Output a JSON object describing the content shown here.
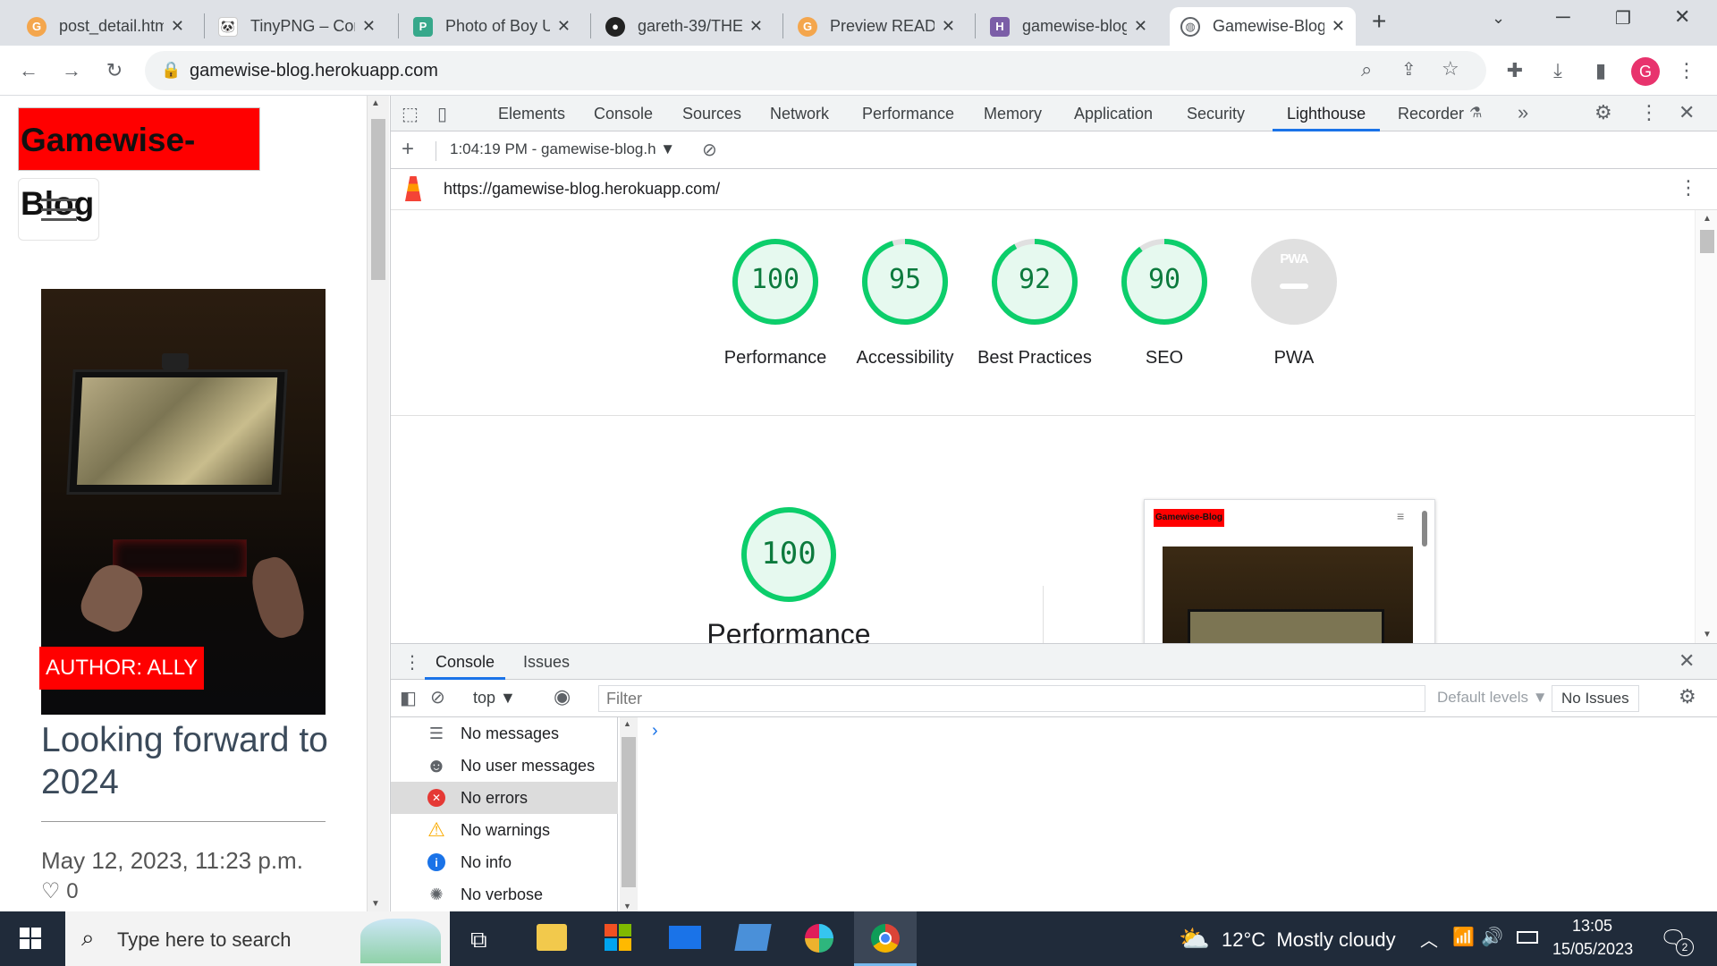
{
  "browser": {
    "tabs": [
      {
        "title": "post_detail.htm",
        "fav_color": "#f4a64d",
        "icon": "gitpod-icon",
        "active": false
      },
      {
        "title": "TinyPNG – Com",
        "fav_color": "#ffffff",
        "icon": "panda-icon",
        "active": false
      },
      {
        "title": "Photo of Boy U",
        "fav_color": "#37a88b",
        "icon": "pexels-icon",
        "active": false
      },
      {
        "title": "gareth-39/THE",
        "fav_color": "#222222",
        "icon": "github-icon",
        "active": false
      },
      {
        "title": "Preview READM",
        "fav_color": "#f4a64d",
        "icon": "gitpod-icon",
        "active": false
      },
      {
        "title": "gamewise-blog",
        "fav_color": "#7b5ea7",
        "icon": "heroku-icon",
        "active": false
      },
      {
        "title": "Gamewise-Blog",
        "fav_color": "#5f6368",
        "icon": "globe-icon",
        "active": true
      }
    ],
    "url": "gamewise-blog.herokuapp.com",
    "profile_initial": "G"
  },
  "page": {
    "brand": "Gamewise-Blog",
    "author_badge": "AUTHOR: ALLY",
    "post_title": "Looking forward to 2024",
    "post_date": "May 12, 2023, 11:23 p.m.",
    "likes": "0"
  },
  "devtools": {
    "tabs": [
      "Elements",
      "Console",
      "Sources",
      "Network",
      "Performance",
      "Memory",
      "Application",
      "Security",
      "Lighthouse",
      "Recorder"
    ],
    "active_tab": "Lighthouse",
    "report_selector": "1:04:19 PM - gamewise-blog.h",
    "report_url": "https://gamewise-blog.herokuapp.com/",
    "scores": [
      {
        "value": "100",
        "label": "Performance",
        "fraction": 1.0
      },
      {
        "value": "95",
        "label": "Accessibility",
        "fraction": 0.95
      },
      {
        "value": "92",
        "label": "Best Practices",
        "fraction": 0.92
      },
      {
        "value": "90",
        "label": "SEO",
        "fraction": 0.9
      }
    ],
    "pwa": {
      "badge": "PWA",
      "label": "PWA"
    },
    "perf_detail": {
      "value": "100",
      "label": "Performance"
    },
    "preview_brand": "Gamewise-Blog",
    "score_color": "#0cce6b"
  },
  "console": {
    "drawer_tabs": [
      "Console",
      "Issues"
    ],
    "context": "top",
    "filter_placeholder": "Filter",
    "levels": "Default levels",
    "issues": "No Issues",
    "sidebar": [
      {
        "label": "No messages",
        "icon": "list-icon"
      },
      {
        "label": "No user messages",
        "icon": "user-icon"
      },
      {
        "label": "No errors",
        "icon": "error-icon"
      },
      {
        "label": "No warnings",
        "icon": "warning-icon"
      },
      {
        "label": "No info",
        "icon": "info-icon"
      },
      {
        "label": "No verbose",
        "icon": "verbose-icon"
      }
    ],
    "prompt": "›"
  },
  "taskbar": {
    "search_placeholder": "Type here to search",
    "weather": "12°C  Mostly cloudy",
    "time": "13:05",
    "date": "15/05/2023",
    "notifications": "2"
  }
}
